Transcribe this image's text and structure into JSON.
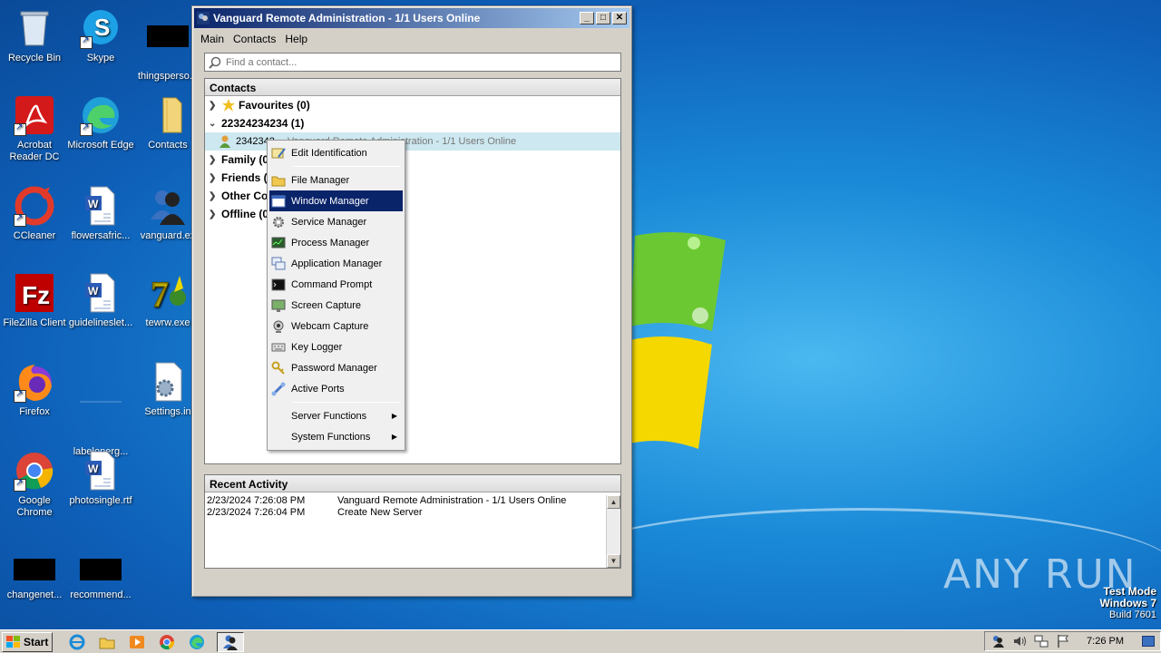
{
  "desktop": {
    "icons": [
      {
        "label": "Recycle Bin",
        "icon": "recycle-bin-icon"
      },
      {
        "label": "Skype",
        "icon": "skype-icon"
      },
      {
        "label": "thingsperso...",
        "icon": "file-icon"
      },
      {
        "label": "Acrobat Reader DC",
        "icon": "acrobat-icon"
      },
      {
        "label": "Microsoft Edge",
        "icon": "edge-icon"
      },
      {
        "label": "Contacts",
        "icon": "folder-icon"
      },
      {
        "label": "CCleaner",
        "icon": "ccleaner-icon"
      },
      {
        "label": "flowersafric...",
        "icon": "word-doc-icon"
      },
      {
        "label": "vanguard.ex",
        "icon": "vanguard-icon"
      },
      {
        "label": "FileZilla Client",
        "icon": "filezilla-icon"
      },
      {
        "label": "guidelineslet...",
        "icon": "word-doc-icon"
      },
      {
        "label": "tewrw.exe",
        "icon": "winrar-sfx-icon"
      },
      {
        "label": "Firefox",
        "icon": "firefox-icon"
      },
      {
        "label": "labelenerg...",
        "icon": "file-icon"
      },
      {
        "label": "Settings.in",
        "icon": "settings-ini-icon"
      },
      {
        "label": "Google Chrome",
        "icon": "chrome-icon"
      },
      {
        "label": "photosingle.rtf",
        "icon": "word-doc-icon"
      },
      {
        "label": "changenet...",
        "icon": "file-icon"
      },
      {
        "label": "recommend...",
        "icon": "file-icon"
      }
    ],
    "watermark": {
      "line1": "Test Mode",
      "line2": "Windows 7",
      "line3": "Build 7601"
    },
    "brand": "ANY RUN"
  },
  "window": {
    "title": "Vanguard Remote Administration - 1/1 Users Online",
    "menu": [
      "Main",
      "Contacts",
      "Help"
    ],
    "search_placeholder": "Find a contact...",
    "contacts_header": "Contacts",
    "groups": [
      {
        "label": "Favourites (0)",
        "expanded": false
      },
      {
        "label": "22324234234 (1)",
        "expanded": true
      },
      {
        "label": "Family (0",
        "expanded": false
      },
      {
        "label": "Friends (",
        "expanded": false
      },
      {
        "label": "Other Con",
        "expanded": false
      },
      {
        "label": "Offline (0",
        "expanded": false
      }
    ],
    "user_row": {
      "id": "2342342",
      "title": "Vanguard Remote Administration - 1/1 Users Online"
    },
    "activity_header": "Recent Activity",
    "activity": [
      {
        "date": "2/23/2024 7:26:08 PM",
        "event": "Vanguard Remote Administration - 1/1 Users Online"
      },
      {
        "date": "2/23/2024 7:26:04 PM",
        "event": "Create New Server"
      }
    ]
  },
  "context_menu": {
    "items": [
      {
        "label": "Edit Identification",
        "icon": "edit-id-icon"
      },
      {
        "label": "File Manager",
        "icon": "folder-icon"
      },
      {
        "label": "Window Manager",
        "icon": "window-icon"
      },
      {
        "label": "Service Manager",
        "icon": "gear-icon"
      },
      {
        "label": "Process Manager",
        "icon": "process-icon"
      },
      {
        "label": "Application Manager",
        "icon": "apps-icon"
      },
      {
        "label": "Command Prompt",
        "icon": "terminal-icon"
      },
      {
        "label": "Screen Capture",
        "icon": "screen-icon"
      },
      {
        "label": "Webcam Capture",
        "icon": "webcam-icon"
      },
      {
        "label": "Key Logger",
        "icon": "keyboard-icon"
      },
      {
        "label": "Password Manager",
        "icon": "key-icon"
      },
      {
        "label": "Active Ports",
        "icon": "ports-icon"
      },
      {
        "label": "Server Functions",
        "icon": ""
      },
      {
        "label": "System Functions",
        "icon": ""
      }
    ],
    "highlighted": "Window Manager"
  },
  "taskbar": {
    "start_label": "Start",
    "clock": "7:26 PM"
  }
}
